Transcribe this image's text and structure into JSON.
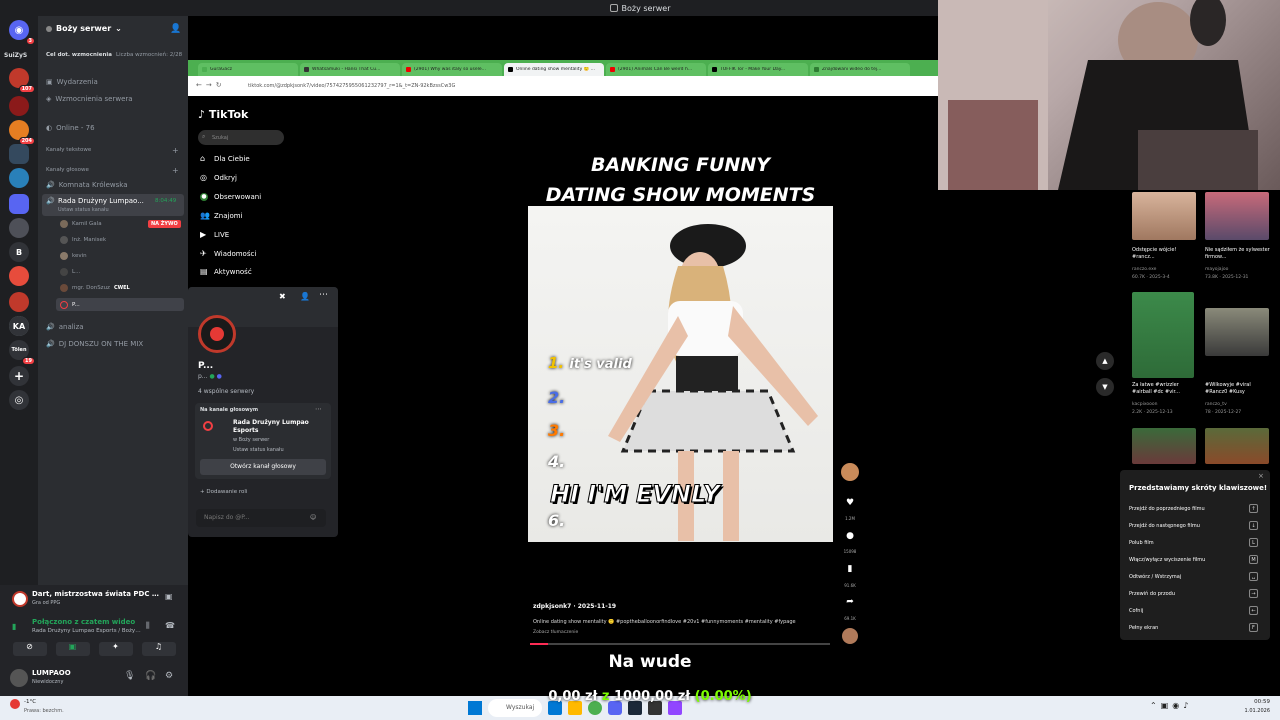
{
  "window": {
    "title": "Boży serwer"
  },
  "rail": {
    "dm_badge": "3",
    "label": "SuiZyS",
    "badges": [
      "107",
      "204",
      "19"
    ],
    "letters": [
      "B",
      "KA",
      "Tölen"
    ]
  },
  "server": {
    "name": "Boży serwer",
    "boost_label": "Cel dot. wzmocnienia",
    "boost_count": "Liczba wzmocnień: 2/28",
    "events": "Wydarzenia",
    "boosts": "Wzmocnienia serwera",
    "online": "Online - 76",
    "cat_text": "Kanały tekstowe",
    "cat_voice": "Kanały głosowe",
    "channels": [
      {
        "name": "Komnata Królewska"
      },
      {
        "name": "Rada Drużyny Lumpao...",
        "time": "8:04:49",
        "status": "Ustaw status kanału"
      }
    ],
    "members": [
      {
        "name": "Kamil Gala",
        "tag": "NA ŻYWO"
      },
      {
        "name": "Inż. Manisek",
        "tag": ""
      },
      {
        "name": "kevin",
        "tag": ""
      },
      {
        "name": "L...",
        "tag": ""
      },
      {
        "name": "mgr. DonSzuz",
        "tag": "CWEL"
      },
      {
        "name": "P...",
        "tag": ""
      }
    ],
    "more_channels": [
      "analiza",
      "DJ DONSZU ON THE MIX"
    ]
  },
  "popup": {
    "name": "P...",
    "handle": "p...",
    "mutual": "4 wspólne serwery",
    "voice_label": "Na kanale głosowym",
    "voice_channel": "Rada Drużyny Lumpao Esports",
    "voice_server": "w Boży serwer",
    "voice_status": "Ustaw status kanału",
    "open_btn": "Otwórz kanał głosowy",
    "added_role": "Dodawanie roli",
    "msg_placeholder": "Napisz do @P..."
  },
  "browser": {
    "tabs": [
      "GuraGacz",
      "Whatsamuki - Hansi That Cu...",
      "(2901) Why was italy so usele...",
      "Online dating show mentality 🙂 ...",
      "(2901) Animals Can Be weird h...",
      "TOFFIK Tor - Make Your Day...",
      "Znajdowani wideo do tej..."
    ],
    "url": "tiktok.com/@zdpkjsonk7/video/7574275955061232797_r=1&_t=ZN-92kBzssCw3G"
  },
  "tiktok": {
    "logo": "TikTok",
    "search_placeholder": "Szukaj",
    "nav": [
      "Dla Ciebie",
      "Odkryj",
      "Obserwowani",
      "Znajomi",
      "LIVE",
      "Wiadomości",
      "Aktywność"
    ],
    "caption_top": [
      "BANKING FUNNY",
      "DATING SHOW MOMENTS"
    ],
    "list_items": [
      "1.",
      "it's valid",
      "2.",
      "3.",
      "4.",
      "6."
    ],
    "overlay_text": "HI I'M EVNLY",
    "author": "zdpkjsonk7 · 2025-11-19",
    "desc": "Online dating show mentality 🙂 #poptheballoonorfindlove #20v1 #funnymoments #mentality #fypage",
    "translate": "Zobacz tłumaczenie",
    "counts": [
      "1.2M",
      "15098",
      "91.6K",
      "69.1K"
    ]
  },
  "sidebar_right": [
    {
      "title": "Odstępcie wójcie! #rancz...",
      "meta": "ranczo.exe",
      "stats": "60.7K · 2025-3-4"
    },
    {
      "title": "Nie sądziłem że sylwester firmow...",
      "meta": "mayojajoo",
      "stats": "73.8K · 2025-12-31"
    },
    {
      "title": "Za łatwe #wrizzler #airball #dc #vir...",
      "meta": "kacpixooon",
      "stats": "2.2K · 2025-12-13"
    },
    {
      "title": "#Wilkowyje #viral #Rancz0 #Kusy",
      "meta": "ranczo_tv",
      "stats": "78 · 2025-12-27"
    }
  ],
  "shortcuts": {
    "title": "Przedstawiamy skróty klawiszowe!",
    "items": [
      {
        "label": "Przejdź do poprzedniego filmu",
        "key": "↑"
      },
      {
        "label": "Przejdź do następnego filmu",
        "key": "↓"
      },
      {
        "label": "Polub film",
        "key": "L"
      },
      {
        "label": "Włącz/wyłącz wyciszenie filmu",
        "key": "M"
      },
      {
        "label": "Odtwórz / Wstrzymaj",
        "key": "␣"
      },
      {
        "label": "Przewiń do przodu",
        "key": "→"
      },
      {
        "label": "Cofnij",
        "key": "←"
      },
      {
        "label": "Pełny ekran",
        "key": "F"
      }
    ]
  },
  "activity": {
    "title": "Dart, mistrzostwa świata PDC - me...",
    "sub": "Gra od PPG"
  },
  "connection": {
    "status": "Połączono z czatem wideo",
    "sub": "Rada Drużyny Lumpao Esports / Boży ..."
  },
  "user": {
    "name": "LUMPAOO",
    "status": "Niewidoczny"
  },
  "overlay": {
    "nawude": "Na wude",
    "donation": "0,00 zł",
    "of": "z",
    "goal": "1000,00 zł",
    "pct": "(0.00%)"
  },
  "taskbar": {
    "weather": "-1°C",
    "weather_sub": "Prawa: bezchm.",
    "search": "Wyszukaj",
    "time": "00:59",
    "date": "1.01.2026"
  },
  "colors": {
    "discord_green": "#23a55a",
    "discord_red": "#f23f43",
    "tiktok_red": "#fe2c55",
    "donation_green": "#7cfc00"
  }
}
